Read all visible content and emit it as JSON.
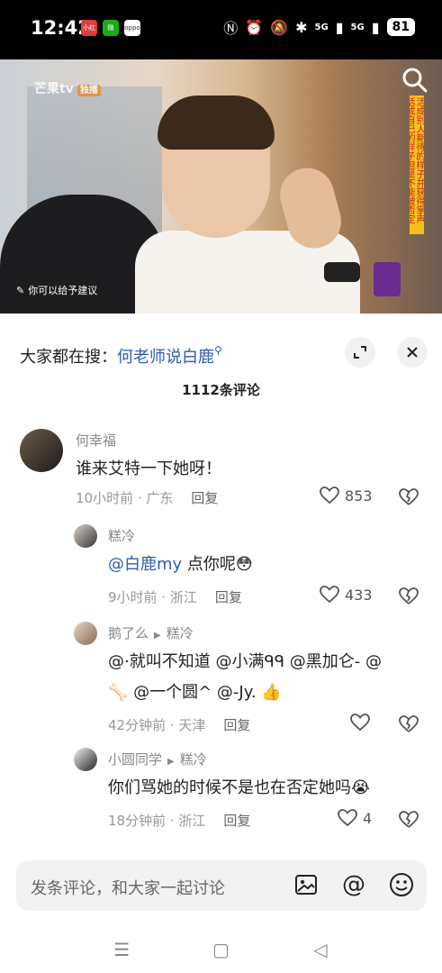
{
  "status_bar": {
    "time": "12:42",
    "apps": [
      {
        "icon": "news-app-icon",
        "label": "小红书",
        "color": "#e23b3b"
      },
      {
        "icon": "wechat-app-icon",
        "label": "微",
        "color": "#1aad19"
      },
      {
        "icon": "oppo-app-icon",
        "label": "oppo",
        "color": "#ffffff"
      }
    ],
    "network_a": "5G",
    "network_b": "5G",
    "battery": "81"
  },
  "video": {
    "logo": "芒果tv",
    "logo_tag": "独播",
    "side_caption": "活成别人期待的样子并获得掌声 活成自己的样子但是不能被否定",
    "subtitle": "你可以给予建议"
  },
  "sheet": {
    "search_prefix": "大家都在搜：",
    "search_keyword": "何老师说白鹿",
    "comment_count": "1112条评论"
  },
  "comments": [
    {
      "user": "何幸福",
      "text": "谁来艾特一下她呀！",
      "time": "10小时前 · 广东",
      "reply": "回复",
      "likes": "853"
    },
    {
      "user": "糕冷",
      "mention": "@白鹿my",
      "text": " 点你呢",
      "time": "9小时前 · 浙江",
      "reply": "回复",
      "likes": "433"
    },
    {
      "user": "鹅了么",
      "reply_to": "糕冷",
      "line1": "@·就叫不知道 @小满ᑫᑫ @黑加仑- @",
      "line2": "🦴 @一个圆^ @-Jy. 👍",
      "time": "42分钟前 · 天津",
      "reply": "回复",
      "likes": ""
    },
    {
      "user": "小圆同学",
      "reply_to": "糕冷",
      "text": "你们骂她的时候不是也在否定她吗😭",
      "time": "18分钟前 · 浙江",
      "reply": "回复",
      "likes": "4"
    }
  ],
  "input": {
    "placeholder": "发条评论，和大家一起讨论"
  },
  "colors": {
    "link": "#2f5bb4",
    "muted": "#999999"
  }
}
